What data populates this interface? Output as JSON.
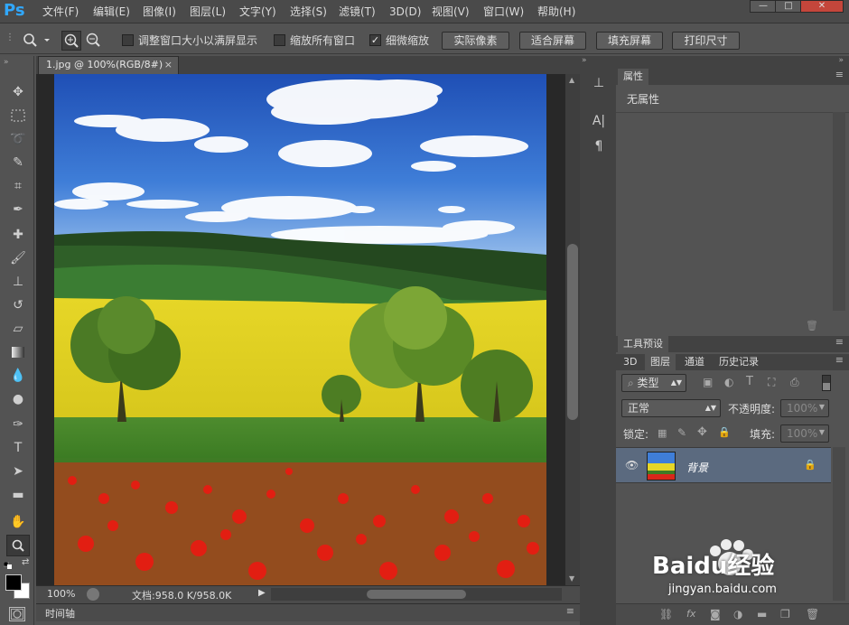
{
  "app": {
    "logo": "Ps"
  },
  "menu": [
    "文件(F)",
    "编辑(E)",
    "图像(I)",
    "图层(L)",
    "文字(Y)",
    "选择(S)",
    "滤镜(T)",
    "3D(D)",
    "视图(V)",
    "窗口(W)",
    "帮助(H)"
  ],
  "window_controls": {
    "minimize": "—",
    "restore": "□",
    "close": "✕"
  },
  "options": {
    "resize_windows_label": "调整窗口大小以满屏显示",
    "zoom_all_label": "缩放所有窗口",
    "scrubby_zoom_label": "细微缩放",
    "scrubby_zoom_checked": true,
    "actual_pixels": "实际像素",
    "fit_screen": "适合屏幕",
    "fill_screen": "填充屏幕",
    "print_size": "打印尺寸"
  },
  "document": {
    "tab_title": "1.jpg @ 100%(RGB/8#)",
    "zoom": "100%",
    "doc_info": "文档:958.0 K/958.0K"
  },
  "timeline": {
    "label": "时间轴"
  },
  "properties": {
    "tab": "属性",
    "empty": "无属性"
  },
  "tool_presets": {
    "tab": "工具预设"
  },
  "layers_panel": {
    "tabs": [
      "3D",
      "图层",
      "通道",
      "历史记录"
    ],
    "active_tab": "图层",
    "filter_kind": "类型",
    "blend_mode": "正常",
    "opacity_label": "不透明度:",
    "opacity_value": "100%",
    "lock_label": "锁定:",
    "fill_label": "填充:",
    "fill_value": "100%",
    "layers": [
      {
        "name": "背景",
        "locked": true,
        "visible": true
      }
    ]
  },
  "watermark": {
    "brand": "Baidu经验",
    "url": "jingyan.baidu.com"
  },
  "colors": {
    "accent": "#31a8ff",
    "selected_layer": "#5b6a7f"
  }
}
